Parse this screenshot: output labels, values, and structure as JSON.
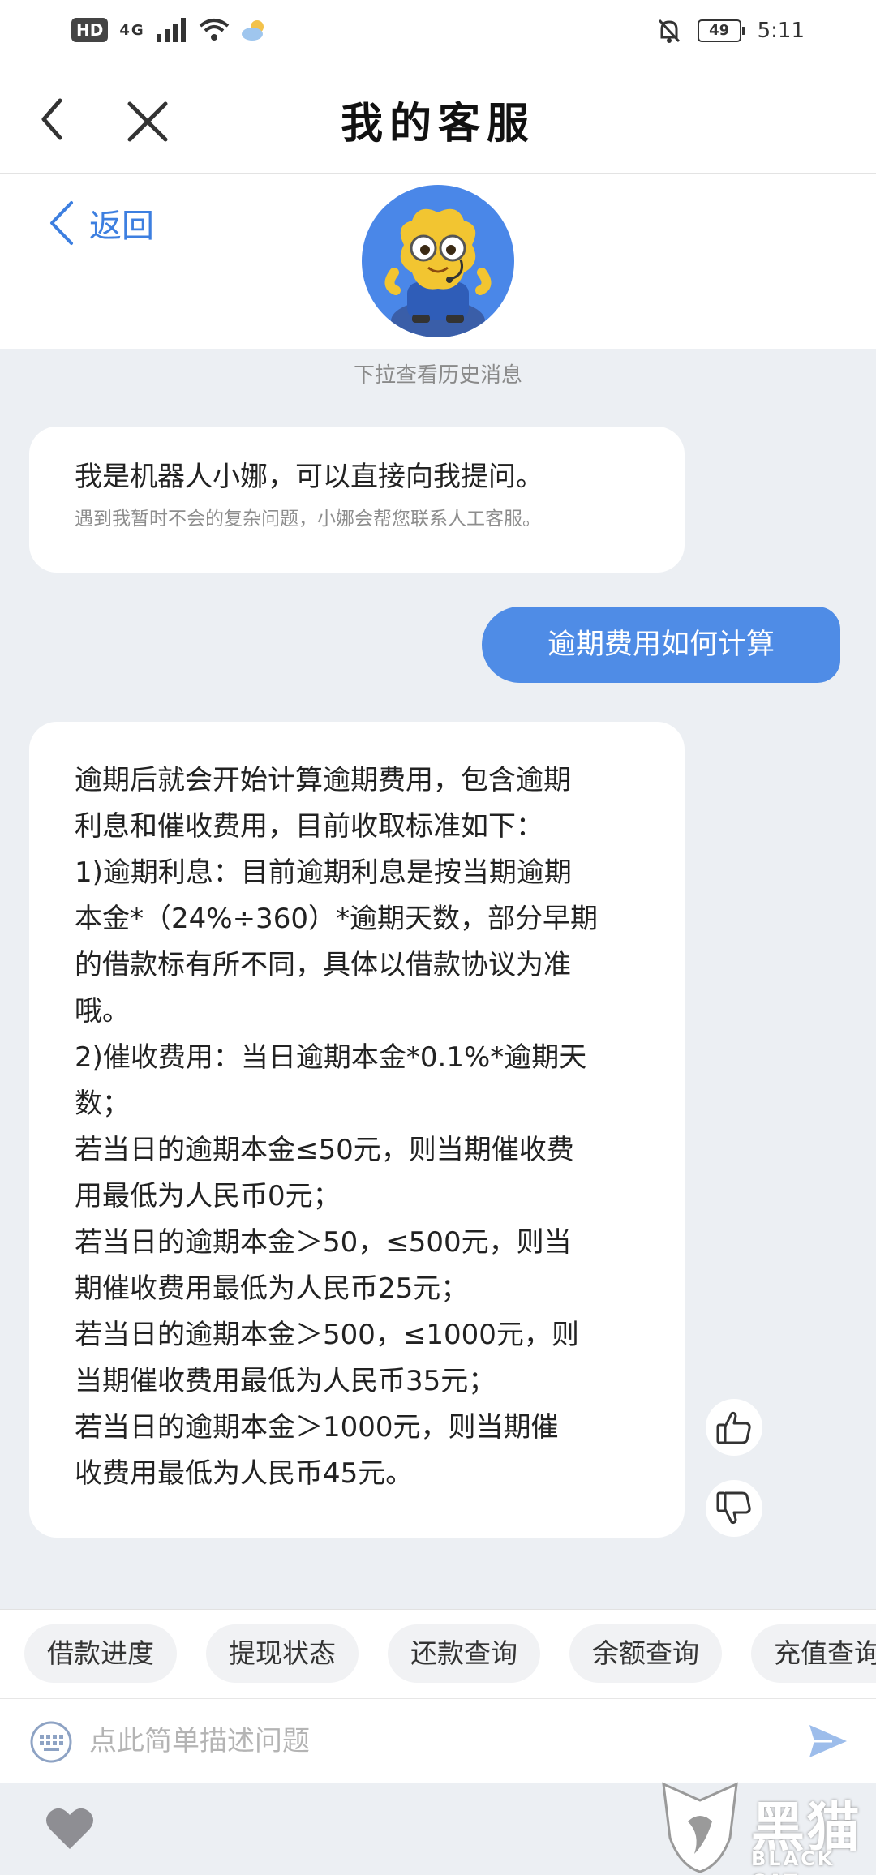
{
  "status_bar": {
    "hd": "HD",
    "network": "4G",
    "battery": "49",
    "time": "5:11"
  },
  "title_bar": {
    "title": "我的客服"
  },
  "header": {
    "return_label": "返回",
    "history_hint": "下拉查看历史消息"
  },
  "messages": {
    "intro_main": "我是机器人小娜，可以直接向我提问。",
    "intro_sub": "遇到我暂时不会的复杂问题，小娜会帮您联系人工客服。",
    "user_question": "逾期费用如何计算",
    "answer_lines": [
      "逾期后就会开始计算逾期费用，包含逾期",
      "利息和催收费用，目前收取标准如下：",
      "1)逾期利息：目前逾期利息是按当期逾期",
      "本金*（24%÷360）*逾期天数，部分早期",
      "的借款标有所不同，具体以借款协议为准",
      "哦。",
      "2)催收费用：当日逾期本金*0.1%*逾期天",
      "数；",
      "若当日的逾期本金≤50元，则当期催收费",
      "用最低为人民币0元；",
      "若当日的逾期本金＞50，≤500元，则当",
      "期催收费用最低为人民币25元；",
      "若当日的逾期本金＞500，≤1000元，则",
      "当期催收费用最低为人民币35元；",
      "若当日的逾期本金＞1000元，则当期催",
      "收费用最低为人民币45元。"
    ]
  },
  "quick_chips": [
    "借款进度",
    "提现状态",
    "还款查询",
    "余额查询",
    "充值查询"
  ],
  "input": {
    "placeholder": "点此简单描述问题",
    "value": ""
  },
  "watermark": {
    "cn": "黑猫",
    "en": "BLACK CAT"
  },
  "colors": {
    "accent": "#4f8ce6",
    "link": "#3d7fe0",
    "background": "#eceff3"
  },
  "icons": [
    "back-icon",
    "close-icon",
    "keyboard-icon",
    "send-icon",
    "heart-icon",
    "thumbs-up-icon",
    "thumbs-down-icon"
  ]
}
